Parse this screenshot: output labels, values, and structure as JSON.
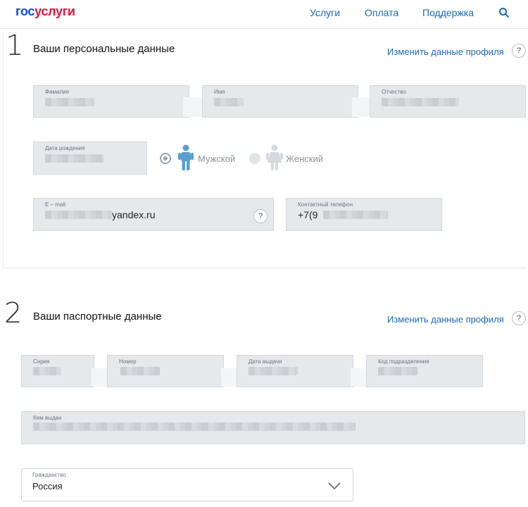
{
  "header": {
    "logo_part1": "гос",
    "logo_part2": "услуги",
    "nav": [
      "Услуги",
      "Оплата",
      "Поддержка"
    ],
    "search_icon": "search-icon"
  },
  "section1": {
    "number": "1",
    "title": "Ваши персональные данные",
    "edit_link": "Изменить данные профиля",
    "help": "?",
    "fields": {
      "lastname_label": "Фамилия",
      "firstname_label": "Имя",
      "patronymic_label": "Отчество",
      "birthdate_label": "Дата рождения",
      "email_label": "E – mail",
      "email_value": "yandex.ru",
      "email_help": "?",
      "phone_label": "Контактный телефон",
      "phone_value": "+7(9"
    },
    "gender": {
      "male_label": "Мужской",
      "female_label": "Женский",
      "selected": "male"
    }
  },
  "section2": {
    "number": "2",
    "title": "Ваши паспортные данные",
    "edit_link": "Изменить данные профиля",
    "help": "?",
    "fields": {
      "series_label": "Серия",
      "number_label": "Номер",
      "issue_date_label": "Дата выдачи",
      "dept_code_label": "Код подразделения",
      "issued_by_label": "Кем выдан",
      "citizenship_label": "Гражданство",
      "citizenship_value": "Россия"
    }
  },
  "colors": {
    "link": "#1a6bb5",
    "field_bg": "#e6e9ec",
    "person_male": "#5b9fd0",
    "person_female": "#d6dadf"
  }
}
